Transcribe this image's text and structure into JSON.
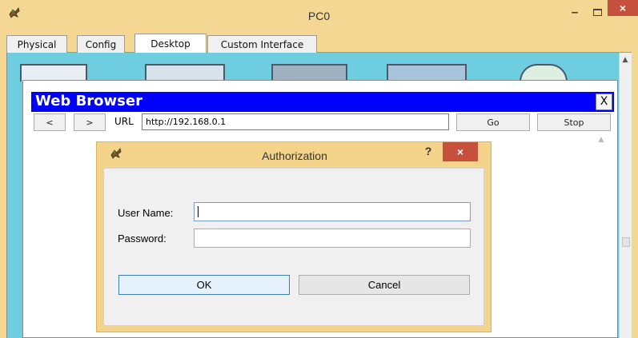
{
  "window": {
    "title": "PC0",
    "minimize_label": "–",
    "close_label": "×"
  },
  "tabs": [
    {
      "label": "Physical",
      "active": false
    },
    {
      "label": "Config",
      "active": false
    },
    {
      "label": "Desktop",
      "active": true
    },
    {
      "label": "Custom Interface",
      "active": false
    }
  ],
  "browser": {
    "title": "Web Browser",
    "close_label": "X",
    "back_label": "<",
    "forward_label": ">",
    "url_label": "URL",
    "url_value": "http://192.168.0.1",
    "go_label": "Go",
    "stop_label": "Stop"
  },
  "dialog": {
    "title": "Authorization",
    "help_label": "?",
    "close_label": "×",
    "username_label": "User Name:",
    "username_value": "",
    "password_label": "Password:",
    "password_value": "",
    "ok_label": "OK",
    "cancel_label": "Cancel"
  },
  "colors": {
    "frame": "#f3d793",
    "desktop": "#6fcde0",
    "browser_titlebar": "#0000ff",
    "close_button": "#c7503d"
  }
}
